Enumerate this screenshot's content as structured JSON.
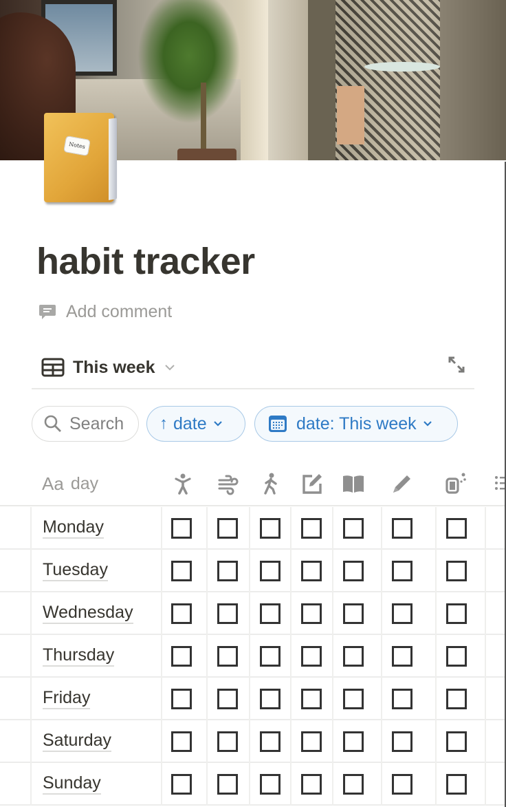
{
  "page": {
    "title": "habit tracker",
    "icon": "notebook-emoji",
    "icon_label": "Notes",
    "add_comment": "Add comment"
  },
  "view": {
    "name": "This week",
    "icon": "table-icon",
    "expand_icon": "expand-arrows-icon"
  },
  "toolbar": {
    "search_placeholder": "Search",
    "sort_arrow": "↑",
    "sort_label": "date",
    "filter_label": "date: This week"
  },
  "table": {
    "title_column_prefix": "Aa",
    "title_column": "day",
    "habit_columns": [
      {
        "icon": "person-arms-up-icon"
      },
      {
        "icon": "wind-icon"
      },
      {
        "icon": "walking-person-icon"
      },
      {
        "icon": "edit-note-icon"
      },
      {
        "icon": "open-book-icon"
      },
      {
        "icon": "pencil-icon"
      },
      {
        "icon": "water-bottle-icon"
      },
      {
        "icon": "bulleted-list-icon"
      }
    ],
    "rows": [
      {
        "day": "Monday",
        "checks": [
          false,
          false,
          false,
          false,
          false,
          false,
          false
        ]
      },
      {
        "day": "Tuesday",
        "checks": [
          false,
          false,
          false,
          false,
          false,
          false,
          false
        ]
      },
      {
        "day": "Wednesday",
        "checks": [
          false,
          false,
          false,
          false,
          false,
          false,
          false
        ]
      },
      {
        "day": "Thursday",
        "checks": [
          false,
          false,
          false,
          false,
          false,
          false,
          false
        ]
      },
      {
        "day": "Friday",
        "checks": [
          false,
          false,
          false,
          false,
          false,
          false,
          false
        ]
      },
      {
        "day": "Saturday",
        "checks": [
          false,
          false,
          false,
          false,
          false,
          false,
          false
        ]
      },
      {
        "day": "Sunday",
        "checks": [
          false,
          false,
          false,
          false,
          false,
          false,
          false
        ]
      }
    ]
  },
  "colors": {
    "text": "#37352f",
    "muted": "#9b9a97",
    "accent_blue": "#2e7ac5",
    "pill_border_blue": "#a7c8e6",
    "icon_gray": "#8f8f8f"
  }
}
